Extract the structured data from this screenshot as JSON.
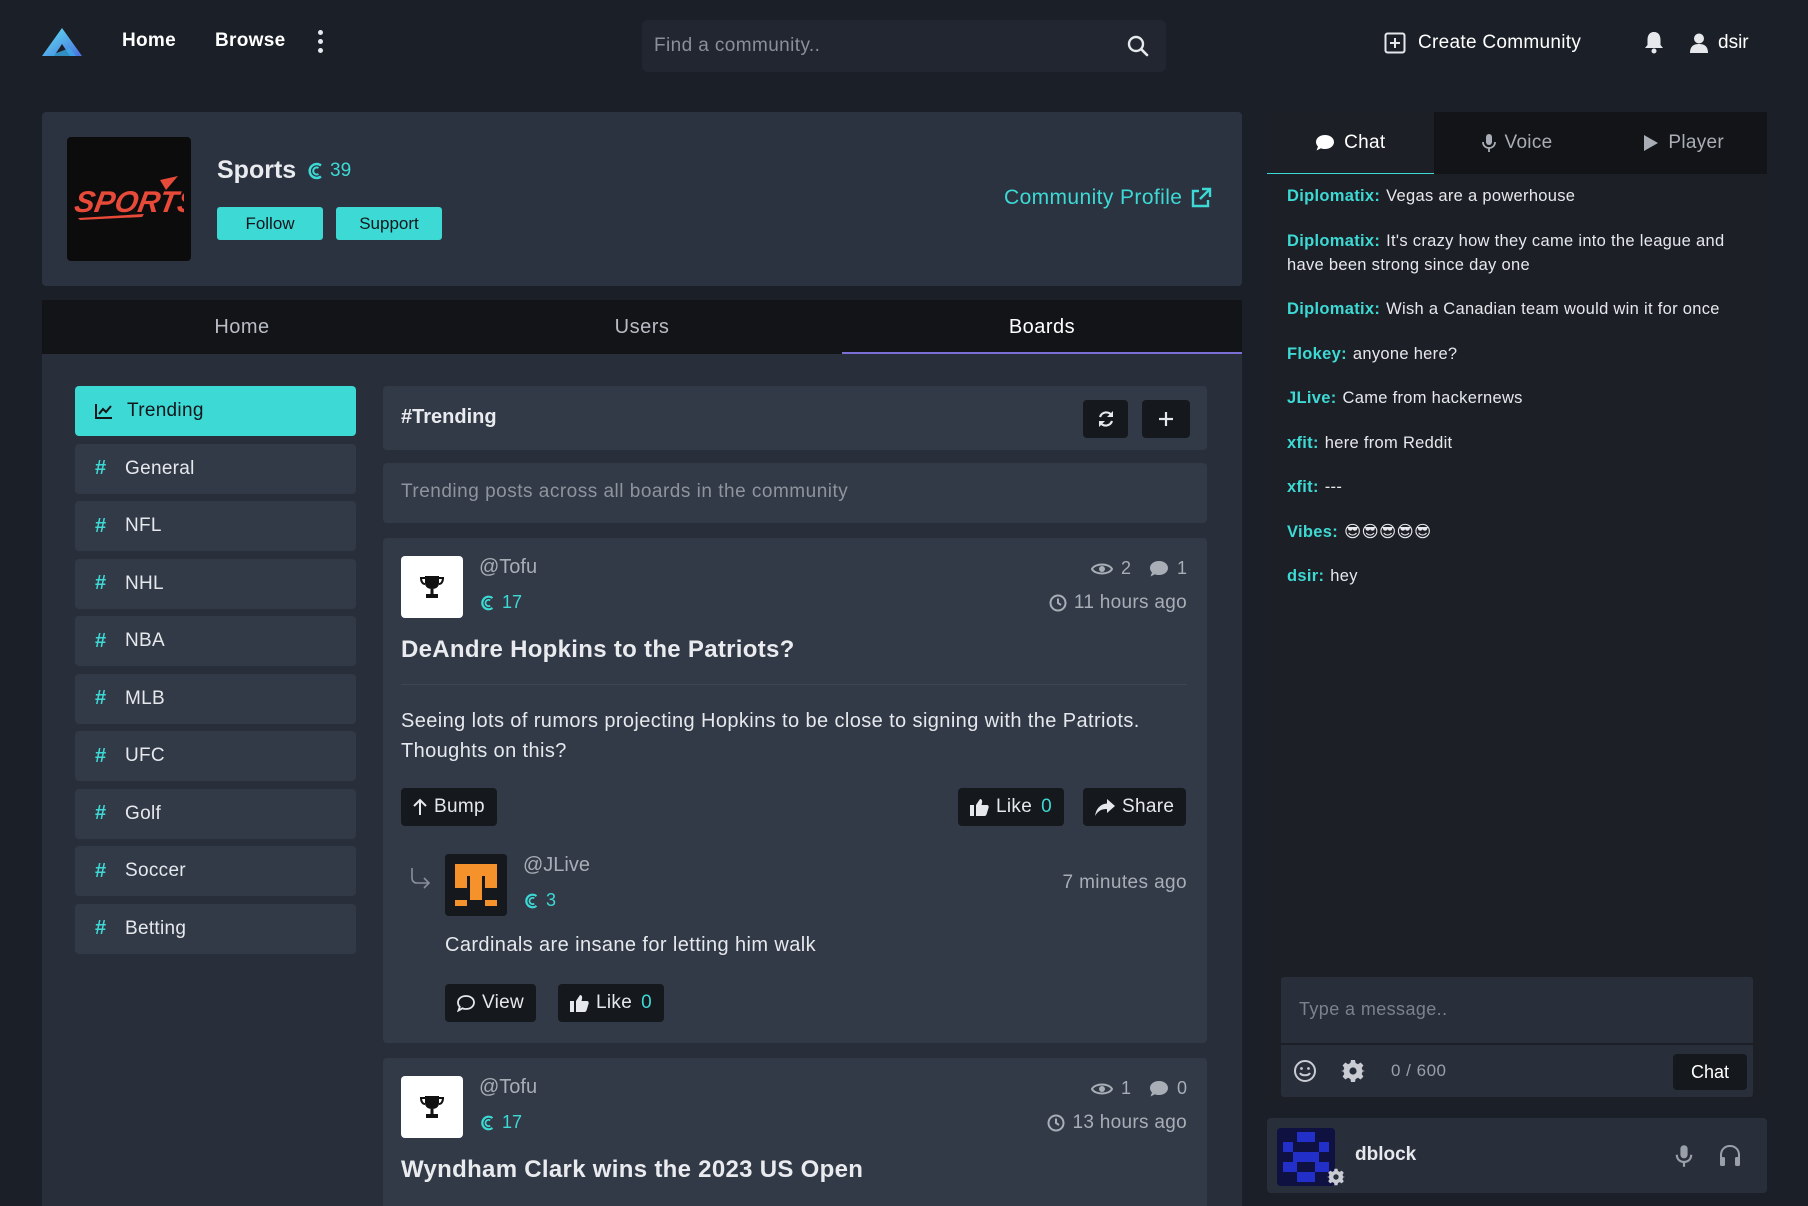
{
  "nav": {
    "home": "Home",
    "browse": "Browse",
    "search_placeholder": "Find a community..",
    "create_community": "Create Community",
    "username": "dsir"
  },
  "community": {
    "name": "Sports",
    "credits": "39",
    "follow": "Follow",
    "support": "Support",
    "profile_link": "Community Profile",
    "tabs": [
      "Home",
      "Users",
      "Boards"
    ],
    "active_tab": "Boards"
  },
  "boards": [
    {
      "label": "Trending",
      "active": true
    },
    {
      "label": "General"
    },
    {
      "label": "NFL"
    },
    {
      "label": "NHL"
    },
    {
      "label": "NBA"
    },
    {
      "label": "MLB"
    },
    {
      "label": "UFC"
    },
    {
      "label": "Golf"
    },
    {
      "label": "Soccer"
    },
    {
      "label": "Betting"
    }
  ],
  "feed": {
    "title": "#Trending",
    "description": "Trending posts across all boards in the community",
    "posts": [
      {
        "author": "@Tofu",
        "credits": "17",
        "views": "2",
        "comments": "1",
        "time": "11 hours ago",
        "title": "DeAndre Hopkins to the Patriots?",
        "body": "Seeing lots of rumors projecting Hopkins to be close to signing with the Patriots. Thoughts on this?",
        "bump": "Bump",
        "like": "Like",
        "likes": "0",
        "share": "Share",
        "reply": {
          "author": "@JLive",
          "credits": "3",
          "time": "7 minutes ago",
          "body": "Cardinals are insane for letting him walk",
          "view": "View",
          "like": "Like",
          "likes": "0"
        }
      },
      {
        "author": "@Tofu",
        "credits": "17",
        "views": "1",
        "comments": "0",
        "time": "13 hours ago",
        "title": "Wyndham Clark wins the 2023 US Open"
      }
    ]
  },
  "chat": {
    "tabs": [
      "Chat",
      "Voice",
      "Player"
    ],
    "messages": [
      {
        "user": "Diplomatix:",
        "text": "Vegas are a powerhouse"
      },
      {
        "user": "Diplomatix:",
        "text": "It's crazy how they came into the league and have been strong since day one"
      },
      {
        "user": "Diplomatix:",
        "text": "Wish a Canadian team would win it for once"
      },
      {
        "user": "Flokey:",
        "text": "anyone here?"
      },
      {
        "user": "JLive:",
        "text": "Came from hackernews"
      },
      {
        "user": "xfit:",
        "text": "here from Reddit"
      },
      {
        "user": "xfit:",
        "text": "---"
      },
      {
        "user": "Vibes:",
        "text": "😎😎😎😎😎"
      },
      {
        "user": "dsir:",
        "text": "hey"
      }
    ],
    "input_placeholder": "Type a message..",
    "char_count": "0 / 600",
    "send": "Chat"
  },
  "voice": {
    "user": "dblock"
  },
  "colors": {
    "accent": "#3dd9d4",
    "background": "#1b1f27",
    "panel": "#2b3341"
  }
}
